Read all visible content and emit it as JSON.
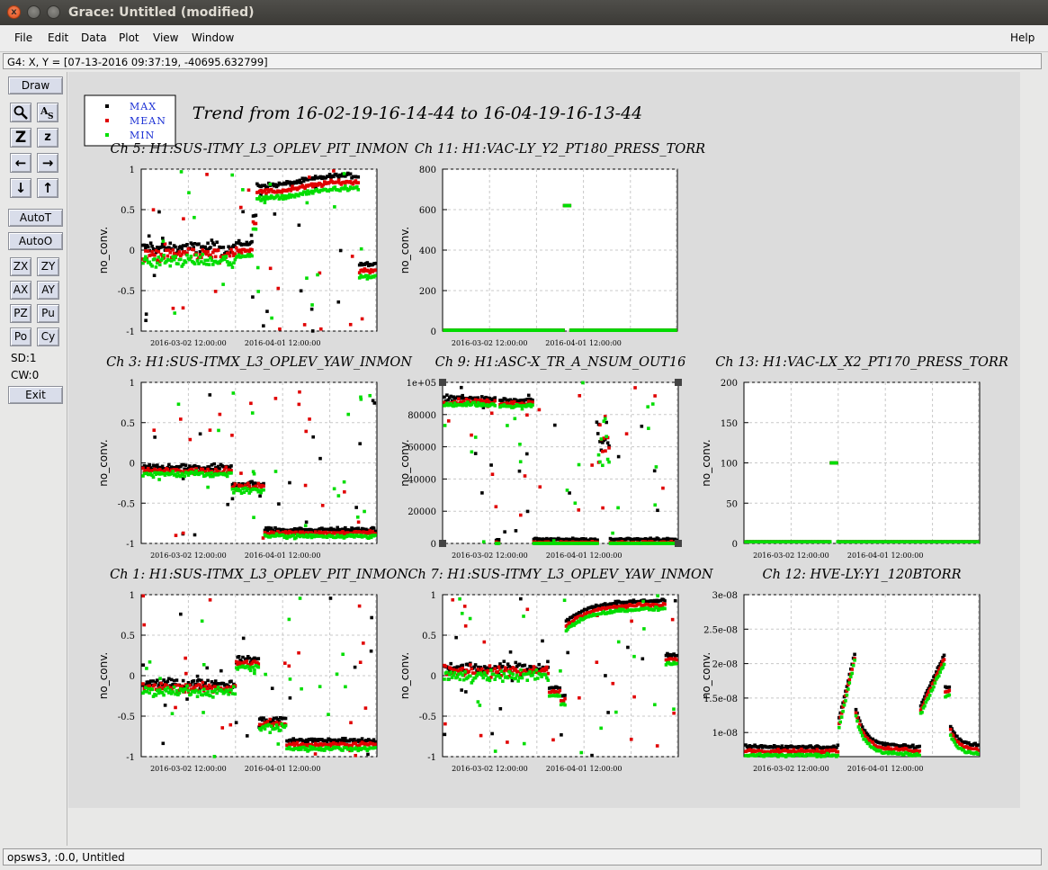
{
  "window": {
    "title": "Grace: Untitled (modified)",
    "close_glyph": "x"
  },
  "menu": {
    "file": "File",
    "edit": "Edit",
    "data": "Data",
    "plot": "Plot",
    "view": "View",
    "window": "Window",
    "help": "Help"
  },
  "locator": "G4: X, Y = [07-13-2016 09:37:19, -40695.632799]",
  "toolbar": {
    "draw": "Draw",
    "autot": "AutoT",
    "autoo": "AutoO",
    "zx": "ZX",
    "zy": "ZY",
    "ax": "AX",
    "ay": "AY",
    "pz": "PZ",
    "pu": "Pu",
    "po": "Po",
    "cy": "Cy",
    "sd": "SD:1",
    "cw": "CW:0",
    "exit": "Exit"
  },
  "status": "opsws3, :0.0, Untitled",
  "figure": {
    "title": "Trend from 16-02-19-16-14-44 to 16-04-19-16-13-44",
    "legend": [
      {
        "label": "MAX",
        "color": "#000000"
      },
      {
        "label": "MEAN",
        "color": "#e00000"
      },
      {
        "label": "MIN",
        "color": "#00e000"
      }
    ],
    "ylabel": "no_conv.",
    "xticks": [
      "2016-03-02 12:00:00",
      "2016-04-01 12:00:00"
    ]
  },
  "chart_data": [
    {
      "type": "scatter",
      "title": "Ch 5: H1:SUS-ITMY_L3_OPLEV_PIT_INMON",
      "ylabel": "no_conv.",
      "ylim": [
        -1,
        1
      ],
      "yticks": [
        "1",
        "0.5",
        "0",
        "-0.5",
        "-1"
      ],
      "xticks": [
        "2016-03-02 12:00:00",
        "2016-04-01 12:00:00"
      ]
    },
    {
      "type": "scatter",
      "title": "Ch 11: H1:VAC-LY_Y2_PT180_PRESS_TORR",
      "ylabel": "no_conv.",
      "ylim": [
        0,
        800
      ],
      "yticks": [
        "800",
        "600",
        "400",
        "200",
        "0"
      ],
      "xticks": [
        "2016-03-02 12:00:00",
        "2016-04-01 12:00:00"
      ]
    },
    {
      "type": "scatter",
      "title": "Ch 3: H1:SUS-ITMX_L3_OPLEV_YAW_INMON",
      "ylabel": "no_conv.",
      "ylim": [
        -1,
        1
      ],
      "yticks": [
        "1",
        "0.5",
        "0",
        "-0.5",
        "-1"
      ],
      "xticks": [
        "2016-03-02 12:00:00",
        "2016-04-01 12:00:00"
      ]
    },
    {
      "type": "scatter",
      "title": "Ch 9: H1:ASC-X_TR_A_NSUM_OUT16",
      "ylabel": "no_conv.",
      "ylim": [
        0,
        100000
      ],
      "yticks": [
        "1e+05",
        "80000",
        "60000",
        "40000",
        "20000",
        "0"
      ],
      "xticks": [
        "2016-03-02 12:00:00",
        "2016-04-01 12:00:00"
      ]
    },
    {
      "type": "scatter",
      "title": "Ch 13: H1:VAC-LX_X2_PT170_PRESS_TORR",
      "ylabel": "no_conv.",
      "ylim": [
        0,
        200
      ],
      "yticks": [
        "200",
        "150",
        "100",
        "50",
        "0"
      ],
      "xticks": [
        "2016-03-02 12:00:00",
        "2016-04-01 12:00:00"
      ]
    },
    {
      "type": "scatter",
      "title": "Ch 1: H1:SUS-ITMX_L3_OPLEV_PIT_INMON",
      "ylabel": "no_conv.",
      "ylim": [
        -1,
        1
      ],
      "yticks": [
        "1",
        "0.5",
        "0",
        "-0.5",
        "-1"
      ],
      "xticks": [
        "2016-03-02 12:00:00",
        "2016-04-01 12:00:00"
      ]
    },
    {
      "type": "scatter",
      "title": "Ch 7: H1:SUS-ITMY_L3_OPLEV_YAW_INMON",
      "ylabel": "no_conv.",
      "ylim": [
        -1,
        1
      ],
      "yticks": [
        "1",
        "0.5",
        "0",
        "-0.5",
        "-1"
      ],
      "xticks": [
        "2016-03-02 12:00:00",
        "2016-04-01 12:00:00"
      ]
    },
    {
      "type": "scatter",
      "title": "Ch 12: HVE-LY:Y1_120BTORR",
      "ylabel": "no_conv.",
      "ylim": [
        6.5e-09,
        3e-08
      ],
      "yticks": [
        "3e-08",
        "2.5e-08",
        "2e-08",
        "1.5e-08",
        "1e-08"
      ],
      "xticks": [
        "2016-03-02 12:00:00",
        "2016-04-01 12:00:00"
      ]
    }
  ]
}
